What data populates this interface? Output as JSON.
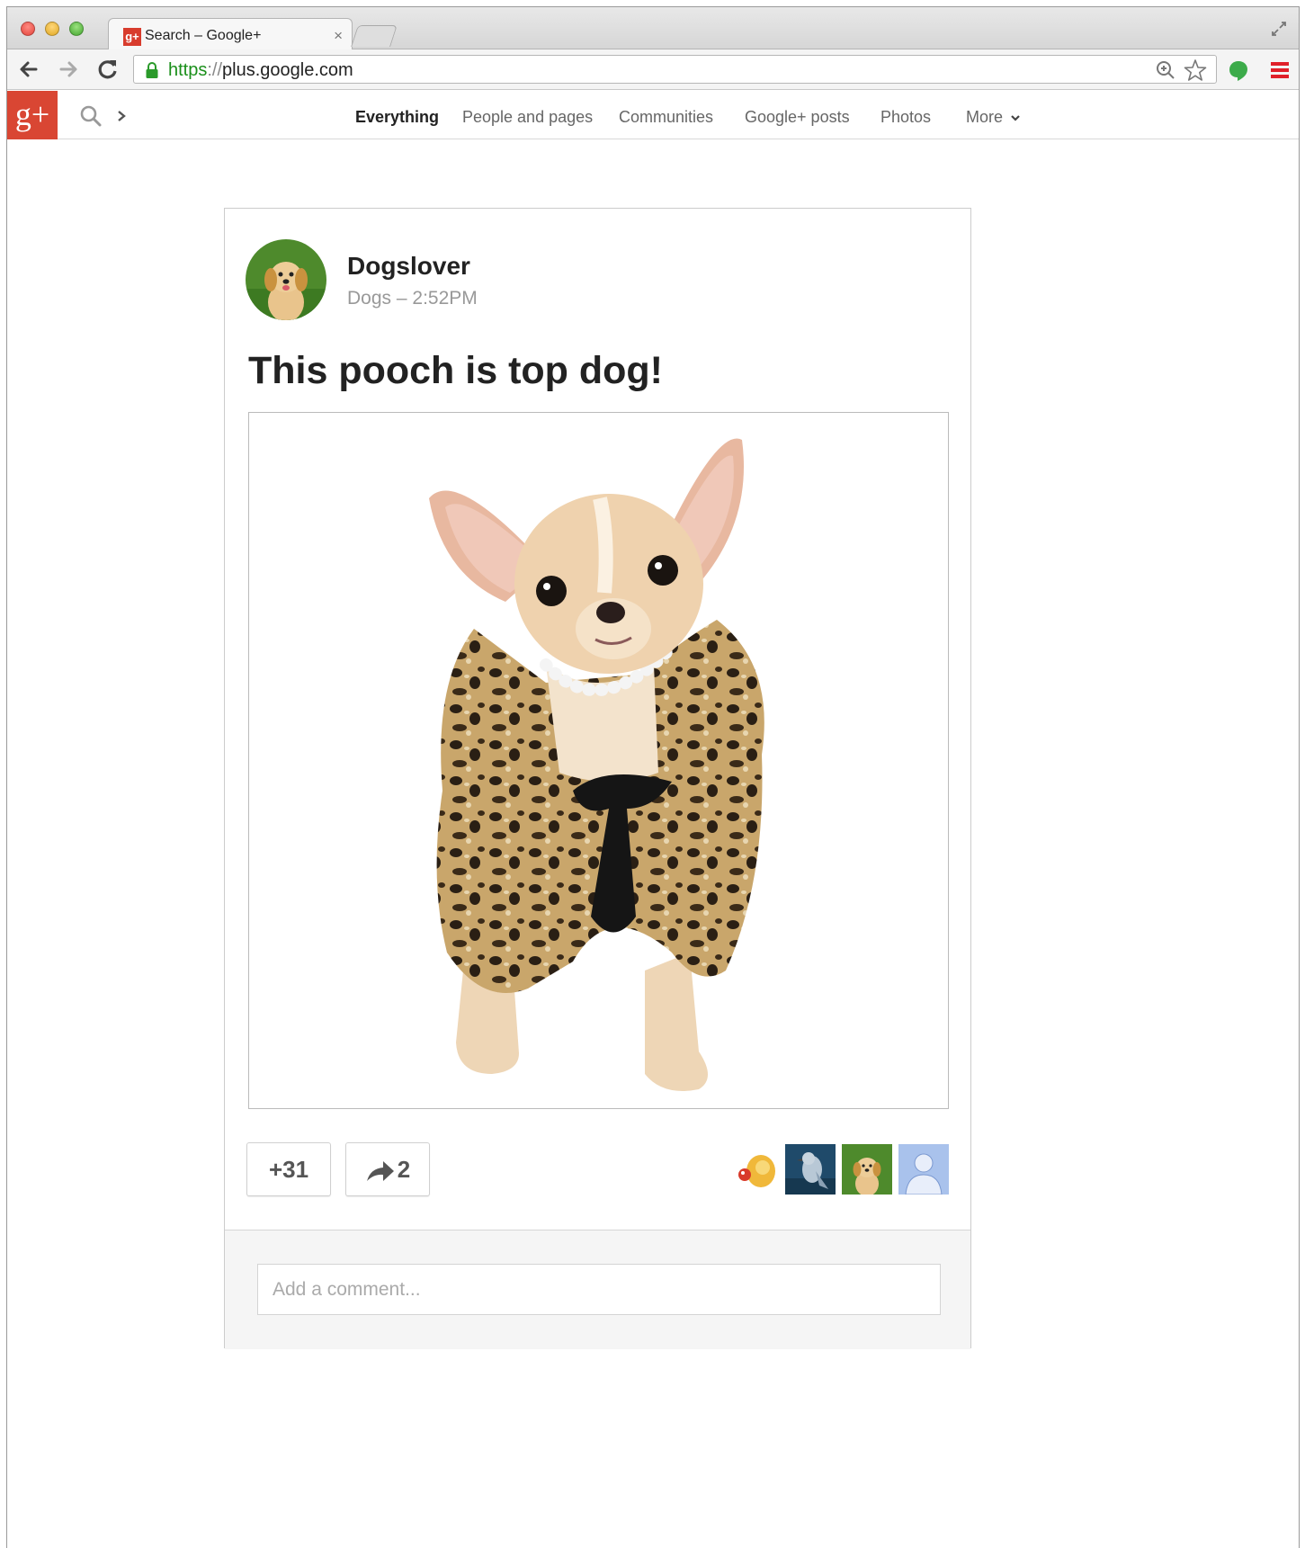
{
  "browser": {
    "tab_title": "Search – Google+",
    "tab_favicon": "g+",
    "tab_close": "×",
    "url_scheme": "https",
    "url_separator": "://",
    "url_host": "plus.google.com",
    "colors": {
      "secure_green": "#1a8f1a",
      "menu_red": "#e0202a",
      "extension_green": "#3cab4a"
    }
  },
  "gplus": {
    "logo": "g+",
    "nav": [
      {
        "label": "Everything",
        "active": true
      },
      {
        "label": "People and pages"
      },
      {
        "label": "Communities"
      },
      {
        "label": "Google+ posts"
      },
      {
        "label": "Photos"
      },
      {
        "label": "More"
      }
    ],
    "colors": {
      "brand_red": "#d94633"
    }
  },
  "post": {
    "author": "Dogslover",
    "community": "Dogs",
    "separator": "–",
    "time": "2:52PM",
    "title": "This pooch is top dog!",
    "plus_count": "+31",
    "share_count": "2",
    "plusoners": [
      {
        "icon": "toy-figurine-avatar"
      },
      {
        "icon": "bird-avatar"
      },
      {
        "icon": "puppy-avatar"
      },
      {
        "icon": "default-person-avatar"
      }
    ],
    "comment_placeholder": "Add a comment..."
  }
}
